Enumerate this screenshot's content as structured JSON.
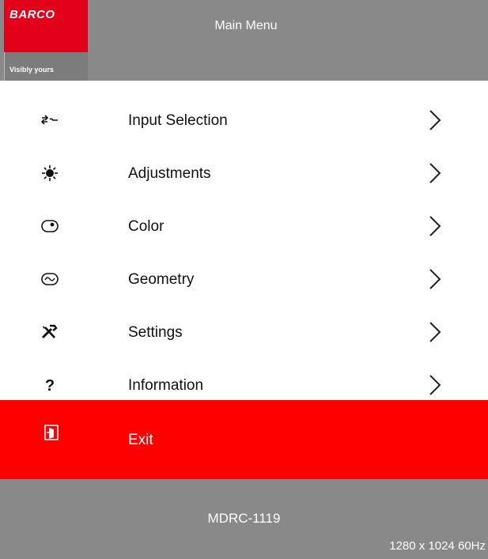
{
  "brand": {
    "logo_text": "BARCO",
    "tagline": "Visibly yours",
    "primary_color": "#e3001b"
  },
  "header": {
    "title": "Main Menu",
    "background": "#898989"
  },
  "menu": {
    "items": [
      {
        "label": "Input Selection",
        "icon": "input-selection-icon"
      },
      {
        "label": "Adjustments",
        "icon": "brightness-icon"
      },
      {
        "label": "Color",
        "icon": "color-icon"
      },
      {
        "label": "Geometry",
        "icon": "geometry-icon"
      },
      {
        "label": "Settings",
        "icon": "settings-tools-icon"
      },
      {
        "label": "Information",
        "icon": "question-icon"
      }
    ],
    "exit": {
      "label": "Exit",
      "icon": "exit-door-icon",
      "highlight_color": "#ff0000"
    }
  },
  "footer": {
    "model": "MDRC-1119",
    "resolution": "1280 x 1024 60Hz"
  }
}
